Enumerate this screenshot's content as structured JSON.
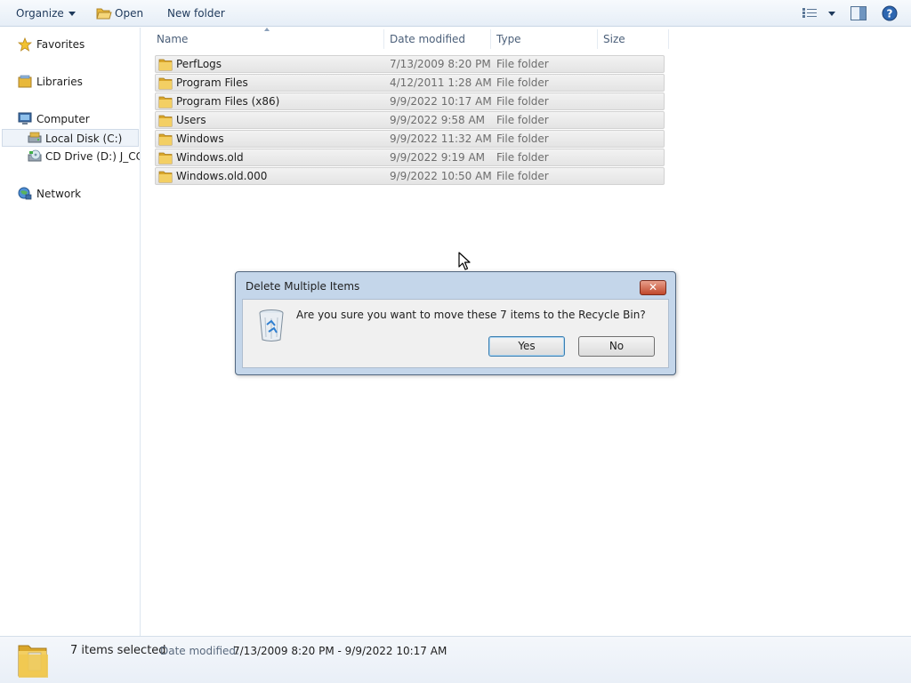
{
  "toolbar": {
    "organize_label": "Organize",
    "open_label": "Open",
    "new_folder_label": "New folder"
  },
  "nav": {
    "favorites": "Favorites",
    "libraries": "Libraries",
    "computer": "Computer",
    "local_disk": "Local Disk (C:)",
    "cd_drive": "CD Drive (D:) J_CCSA",
    "network": "Network"
  },
  "columns": {
    "name": "Name",
    "date": "Date modified",
    "type": "Type",
    "size": "Size"
  },
  "files": [
    {
      "name": "PerfLogs",
      "date": "7/13/2009 8:20 PM",
      "type": "File folder"
    },
    {
      "name": "Program Files",
      "date": "4/12/2011 1:28 AM",
      "type": "File folder"
    },
    {
      "name": "Program Files (x86)",
      "date": "9/9/2022 10:17 AM",
      "type": "File folder"
    },
    {
      "name": "Users",
      "date": "9/9/2022 9:58 AM",
      "type": "File folder"
    },
    {
      "name": "Windows",
      "date": "9/9/2022 11:32 AM",
      "type": "File folder"
    },
    {
      "name": "Windows.old",
      "date": "9/9/2022 9:19 AM",
      "type": "File folder"
    },
    {
      "name": "Windows.old.000",
      "date": "9/9/2022 10:50 AM",
      "type": "File folder"
    }
  ],
  "dialog": {
    "title": "Delete Multiple Items",
    "message": "Are you sure you want to move these 7 items to the Recycle Bin?",
    "yes_label": "Yes",
    "no_label": "No",
    "close_glyph": "✕"
  },
  "status": {
    "count": "7 items selected",
    "date_label": "Date modified:",
    "date_value": "7/13/2009 8:20 PM - 9/9/2022 10:17 AM"
  },
  "colors": {
    "folder": "#e8b83a",
    "accent": "#1e395b",
    "close": "#c0472b"
  }
}
